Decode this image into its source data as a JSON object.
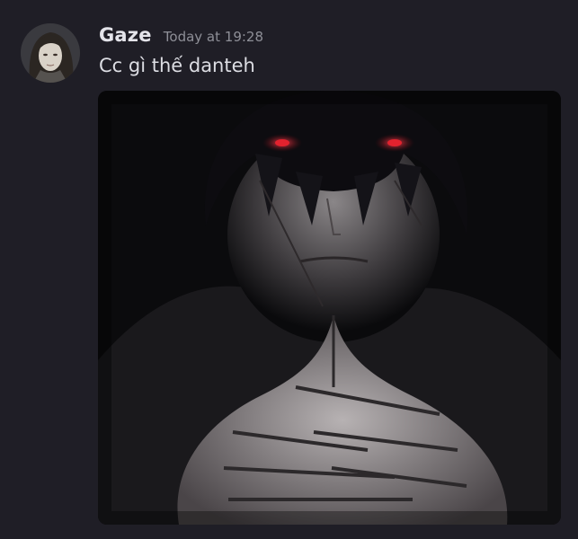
{
  "message": {
    "author": "Gaze",
    "timestamp": "Today at 19:28",
    "text": "Cc gì thế danteh"
  },
  "avatar": {
    "icon": "user-avatar-portrait"
  },
  "attachment": {
    "icon": "anime-character-image"
  },
  "colors": {
    "background": "#1f1e26",
    "username": "#e4e4ea",
    "timestamp": "#8e8f97",
    "text": "#dcdde3",
    "eye_accent": "#c81e28"
  }
}
